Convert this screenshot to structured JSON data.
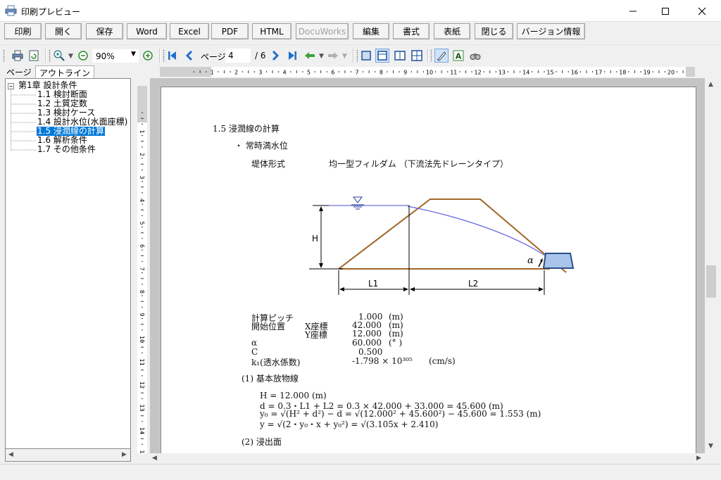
{
  "window": {
    "title": "印刷プレビュー"
  },
  "toolbar": {
    "buttons": [
      {
        "label": "印刷"
      },
      {
        "label": "開く"
      },
      {
        "label": "保存"
      },
      {
        "label": "Word"
      },
      {
        "label": "Excel"
      },
      {
        "label": "PDF"
      },
      {
        "label": "HTML"
      },
      {
        "label": "DocuWorks",
        "disabled": true
      },
      {
        "label": "編集"
      },
      {
        "label": "書式"
      },
      {
        "label": "表紙"
      },
      {
        "label": "閉じる"
      },
      {
        "label": "バージョン情報"
      }
    ]
  },
  "iconbar": {
    "zoom_value": "90%",
    "page_label": "ページ",
    "page_value": "4",
    "page_total": "/ 6"
  },
  "sidebar": {
    "tabs": [
      {
        "label": "ページ"
      },
      {
        "label": "アウトライン",
        "active": true
      }
    ],
    "tree": [
      {
        "label": "第1章 設計条件",
        "level": 0
      },
      {
        "label": "1.1 検討断面",
        "level": 1
      },
      {
        "label": "1.2 土質定数",
        "level": 1
      },
      {
        "label": "1.3 検討ケース",
        "level": 1
      },
      {
        "label": "1.4 設計水位(水面座標)",
        "level": 1
      },
      {
        "label": "1.5 浸潤線の計算",
        "level": 1,
        "selected": true
      },
      {
        "label": "1.6 解析条件",
        "level": 1
      },
      {
        "label": "1.7 その他条件",
        "level": 1
      }
    ]
  },
  "rulers": {
    "h_labels": [
      "1",
      "2",
      "3",
      "4",
      "5",
      "6",
      "7",
      "8",
      "9",
      "10",
      "11",
      "12",
      "13",
      "14",
      "15",
      "16",
      "17",
      "18",
      "19",
      "20"
    ],
    "v_labels": [
      "1",
      "2",
      "3",
      "4",
      "5",
      "6",
      "7",
      "8",
      "9",
      "10",
      "11",
      "12",
      "13",
      "14",
      "15"
    ]
  },
  "document": {
    "section_title": "1.5 浸潤線の計算",
    "subsection": "・ 常時満水位",
    "dam_type_label": "堤体形式",
    "dam_type_value": "均一型フィルダム （下流法先ドレーンタイプ）",
    "diagram": {
      "h_label": "H",
      "l1_label": "L1",
      "l2_label": "L2",
      "alpha_label": "α"
    },
    "params": [
      {
        "label": "計算ピッチ",
        "sub": "",
        "value": "1.000",
        "unit": "(m)"
      },
      {
        "label": "開始位置",
        "sub": "X座標",
        "value": "42.000",
        "unit": "(m)"
      },
      {
        "label": "",
        "sub": "Y座標",
        "value": "12.000",
        "unit": "(m)"
      },
      {
        "label": "α",
        "sub": "",
        "value": "60.000",
        "unit": "(° )"
      },
      {
        "label": "C",
        "sub": "",
        "value": "0.500",
        "unit": ""
      },
      {
        "label": "k₁(透水係数)",
        "sub": "",
        "value": "-1.798 × 10³⁰⁵",
        "unit": "(cm/s)"
      }
    ],
    "heading1": "(1) 基本放物線",
    "formulas": [
      "H = 12.000 (m)",
      "d = 0.3・L1 + L2 = 0.3 × 42.000 + 33.000 = 45.600 (m)",
      "y₀ = √(H² + d²) − d = √(12.000² + 45.600²) − 45.600 = 1.553 (m)",
      "y = √(2・y₀・x + y₀²) = √(3.105x + 2.410)"
    ],
    "heading2": "(2) 浸出面"
  },
  "colors": {
    "selection": "#0078d7",
    "dam_outline": "#a0662a",
    "seepage_line": "#6a6adf",
    "icon_blue": "#1e6fd0"
  }
}
